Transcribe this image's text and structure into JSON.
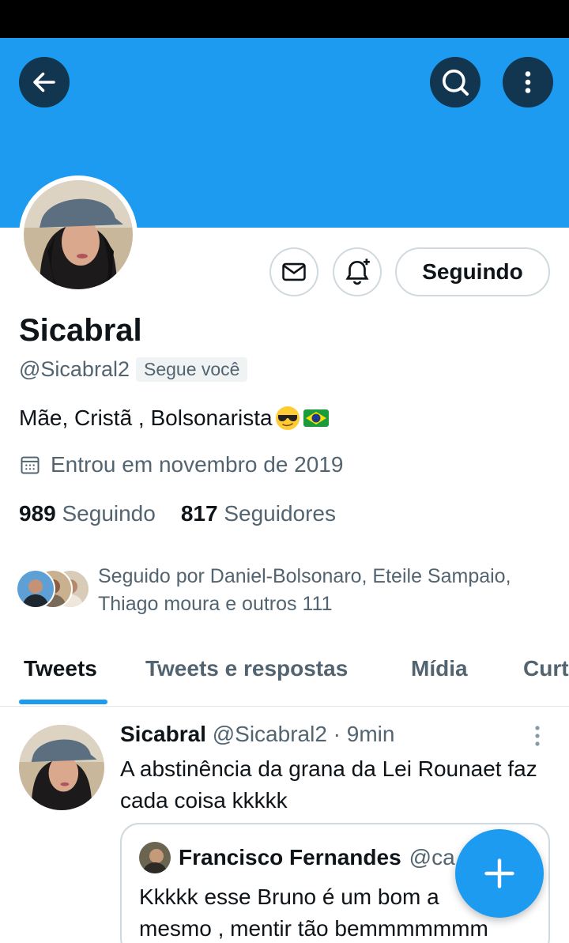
{
  "colors": {
    "accent": "#1d9bf0",
    "banner": "#1d9bf0",
    "text_primary": "#0f1419",
    "text_secondary": "#536471"
  },
  "icons": {
    "back": "arrow-left-icon",
    "search": "search-icon",
    "more": "more-vertical-icon",
    "message": "envelope-icon",
    "notify": "bell-plus-icon",
    "calendar": "calendar-icon",
    "compose": "plus-icon",
    "tweet_more": "more-vertical-icon"
  },
  "profile": {
    "display_name": "Sicabral",
    "handle": "@Sicabral2",
    "follows_you": "Segue você",
    "bio": "Mãe, Cristã ,  Bolsonarista",
    "bio_emoji": [
      "sunglasses-face",
      "brazil-flag"
    ],
    "joined": "Entrou em novembro de 2019",
    "following_button": "Seguindo",
    "stats": {
      "following_count": "989",
      "following_label": "Seguindo",
      "followers_count": "817",
      "followers_label": "Seguidores"
    },
    "followed_by": "Seguido por Daniel-Bolsonaro, Eteile Sampaio, Thiago moura e outros 111"
  },
  "tabs": [
    {
      "label": "Tweets",
      "active": true
    },
    {
      "label": "Tweets e respostas",
      "active": false
    },
    {
      "label": "Mídia",
      "active": false
    },
    {
      "label": "Curt",
      "active": false
    }
  ],
  "tweet": {
    "author": "Sicabral",
    "handle": "@Sicabral2",
    "time": "· 9min",
    "text": "A abstinência da grana da Lei Rounaet faz cada coisa kkkkk",
    "quote": {
      "author": "Francisco Fernandes",
      "handle": "@ca",
      "text_line1": "Kkkkk esse Bruno é um bom a",
      "text_line2": "mesmo , mentir tão bemmmmmmm"
    }
  }
}
